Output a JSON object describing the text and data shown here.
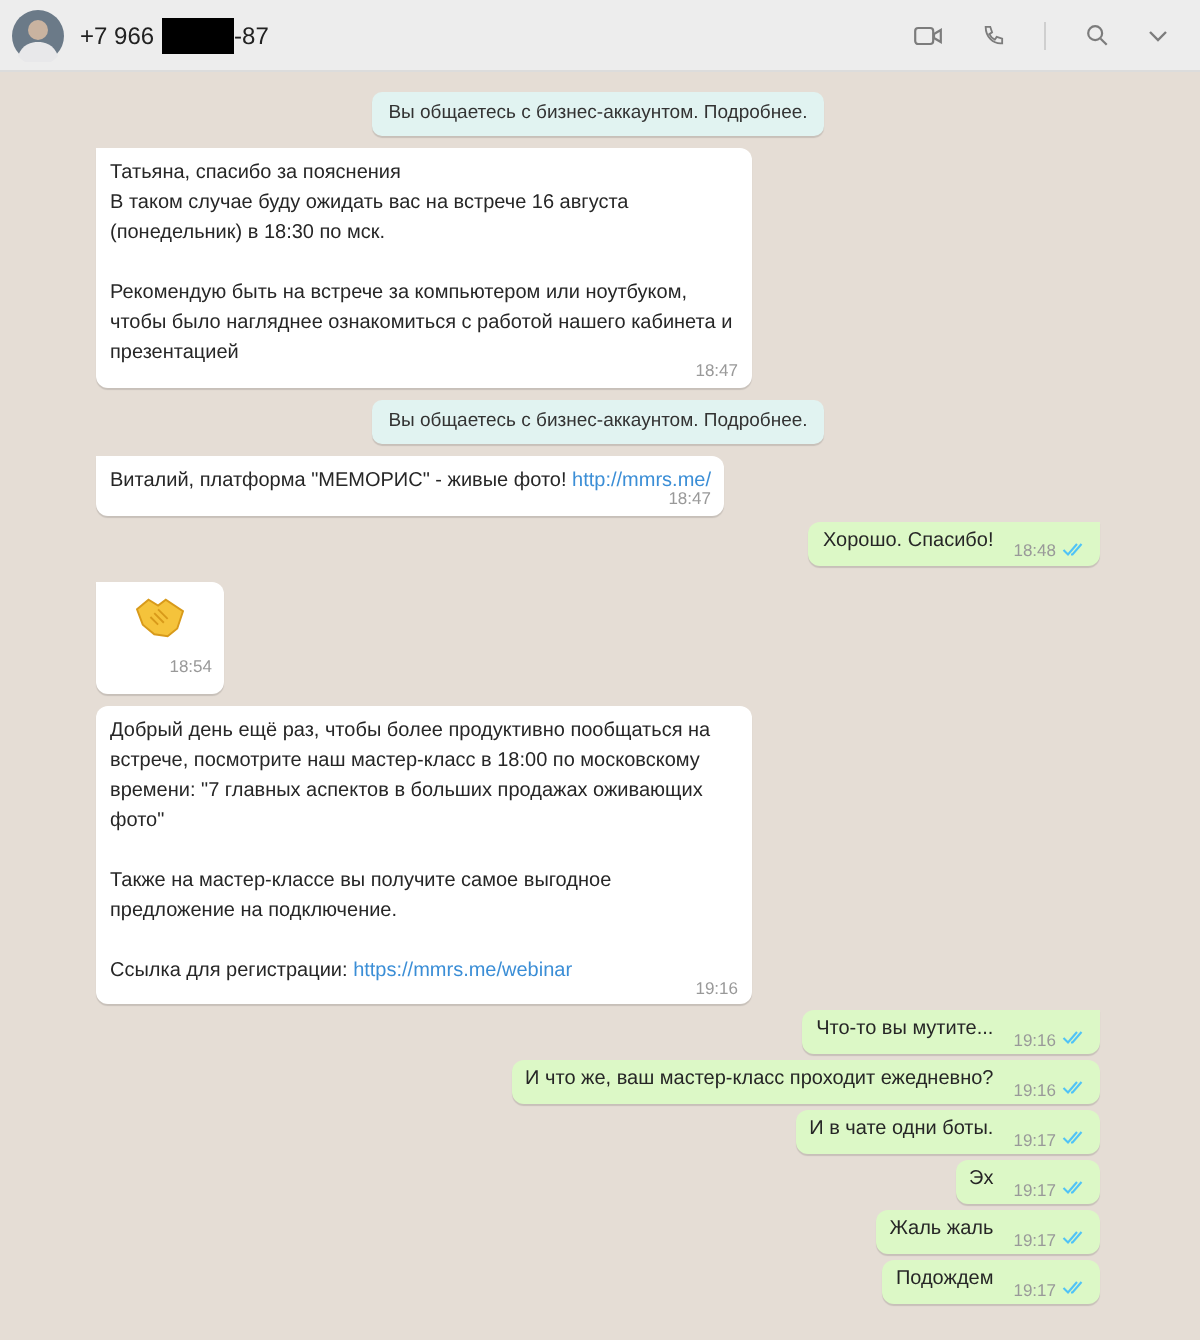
{
  "header": {
    "contact_prefix": "+7 966",
    "contact_suffix": "-87"
  },
  "messages": [
    {
      "kind": "system",
      "text": "Вы общаетесь с бизнес-аккаунтом. Подробнее."
    },
    {
      "kind": "in",
      "tail": true,
      "text": "Татьяна, спасибо за пояснения\nВ таком случае буду ожидать вас на встрече 16 августа (понедельник) в 18:30 по мск.\n\nРекомендую быть на встрече за компьютером или ноутбуком, чтобы было нагляднее ознакомиться с работой нашего кабинета и презентацией",
      "time": "18:47"
    },
    {
      "kind": "system",
      "text": "Вы общаетесь с бизнес-аккаунтом. Подробнее."
    },
    {
      "kind": "in",
      "tail": true,
      "text": "Виталий, платформа \"МЕМОРИС\" - живые фото! ",
      "link": "http://mmrs.me/",
      "time": "18:47"
    },
    {
      "kind": "out",
      "tail": true,
      "text": "Хорошо. Спасибо!",
      "time": "18:48",
      "read": true
    },
    {
      "kind": "sticker",
      "tail": true,
      "time": "18:54"
    },
    {
      "kind": "in",
      "tail": false,
      "text": "Добрый день ещё раз, чтобы более продуктивно пообщаться на встрече, посмотрите наш мастер-класс в 18:00 по московскому времени: \"7 главных аспектов в больших продажах оживающих фото\"\n\nТакже на мастер-классе вы получите самое выгодное предложение на подключение.\n\nСсылка для регистрации: ",
      "link": "https://mmrs.me/webinar",
      "time": "19:16"
    },
    {
      "kind": "out",
      "tail": true,
      "text": "Что-то вы мутите...",
      "time": "19:16",
      "read": true
    },
    {
      "kind": "out",
      "tail": false,
      "text": "И что же, ваш мастер-класс проходит ежедневно?",
      "time": "19:16",
      "read": true
    },
    {
      "kind": "out",
      "tail": false,
      "text": "И в чате одни боты.",
      "time": "19:17",
      "read": true
    },
    {
      "kind": "out",
      "tail": false,
      "text": "Эх",
      "time": "19:17",
      "read": true
    },
    {
      "kind": "out",
      "tail": false,
      "text": "Жаль жаль",
      "time": "19:17",
      "read": true
    },
    {
      "kind": "out",
      "tail": false,
      "text": "Подождем",
      "time": "19:17",
      "read": true
    }
  ]
}
